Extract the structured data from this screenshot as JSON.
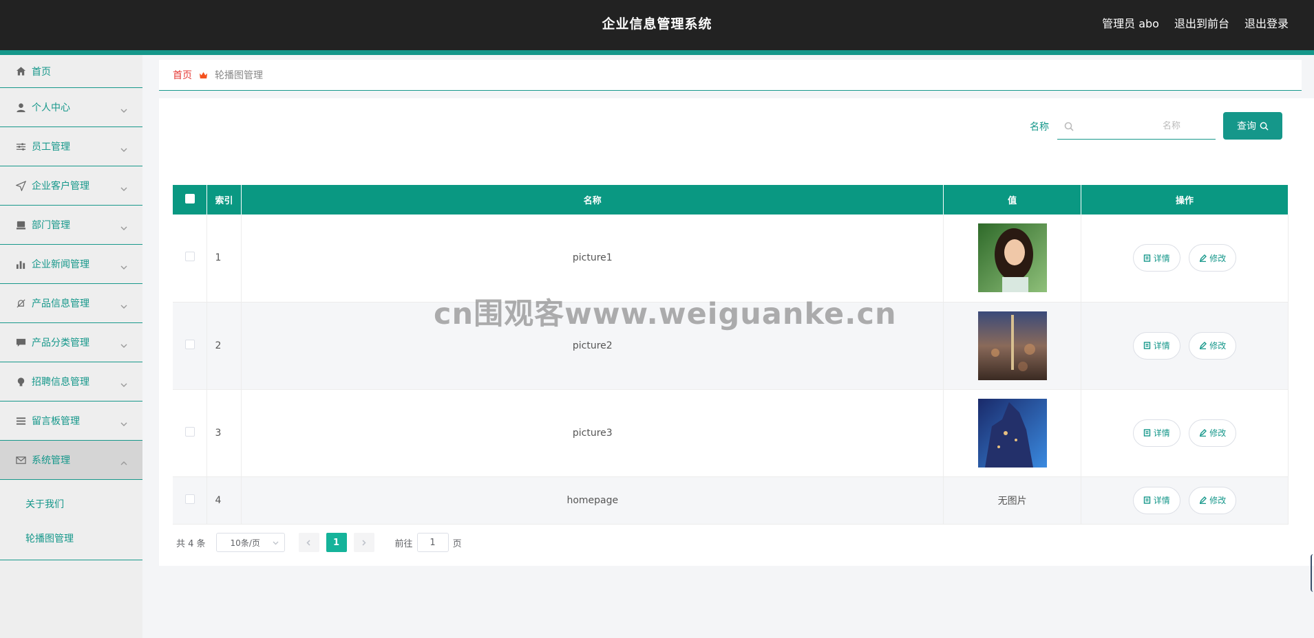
{
  "header": {
    "title": "企业信息管理系统",
    "links": [
      "管理员 abo",
      "退出到前台",
      "退出登录"
    ]
  },
  "sidebar": {
    "items": [
      {
        "label": "首页",
        "icon": "home-icon"
      },
      {
        "label": "个人中心",
        "icon": "user-icon"
      },
      {
        "label": "员工管理",
        "icon": "sliders-icon"
      },
      {
        "label": "企业客户管理",
        "icon": "send-icon"
      },
      {
        "label": "部门管理",
        "icon": "box-icon"
      },
      {
        "label": "企业新闻管理",
        "icon": "bar-chart-icon"
      },
      {
        "label": "产品信息管理",
        "icon": "bell-off-icon"
      },
      {
        "label": "产品分类管理",
        "icon": "chat-icon"
      },
      {
        "label": "招聘信息管理",
        "icon": "bulb-icon"
      },
      {
        "label": "留言板管理",
        "icon": "list-icon"
      },
      {
        "label": "系统管理",
        "icon": "mail-icon"
      }
    ],
    "sub_items": [
      "关于我们",
      "轮播图管理"
    ]
  },
  "breadcrumb": {
    "home": "首页",
    "current": "轮播图管理"
  },
  "search": {
    "label": "名称",
    "placeholder": "名称",
    "button": "查询"
  },
  "table": {
    "headers": [
      "索引",
      "名称",
      "值",
      "操作"
    ],
    "rows": [
      {
        "index": "1",
        "name": "picture1",
        "value": "",
        "has_image": true
      },
      {
        "index": "2",
        "name": "picture2",
        "value": "",
        "has_image": true
      },
      {
        "index": "3",
        "name": "picture3",
        "value": "",
        "has_image": true
      },
      {
        "index": "4",
        "name": "homepage",
        "value": "无图片",
        "has_image": false
      }
    ],
    "detail_label": "详情",
    "edit_label": "修改"
  },
  "pagination": {
    "total": "共 4 条",
    "page_size": "10条/页",
    "current_page": "1",
    "goto_prefix": "前往",
    "goto_value": "1",
    "goto_suffix": "页"
  },
  "watermark": "cn围观客www.weiguanke.cn",
  "colors": {
    "header_bg": "#222222",
    "accent": "#15978a",
    "table_header": "#0a9882",
    "breadcrumb_home": "#e53935"
  }
}
